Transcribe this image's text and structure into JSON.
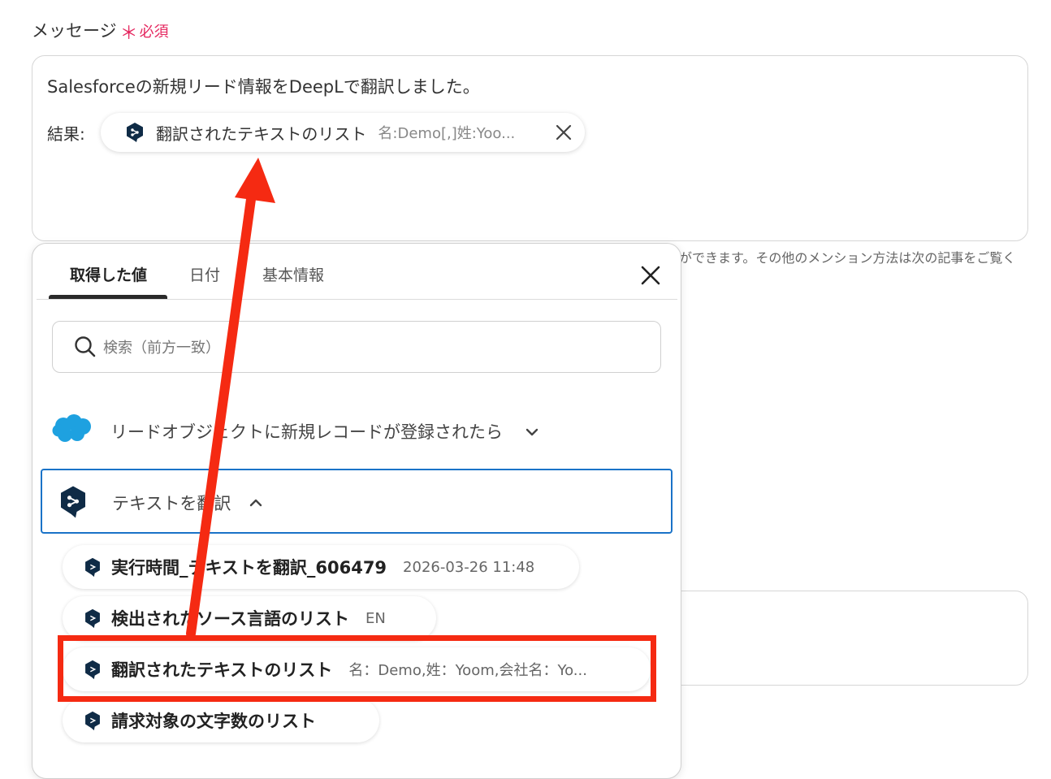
{
  "field": {
    "label": "メッセージ",
    "required_star": "＊",
    "required_text": "必須"
  },
  "message": {
    "line1": "Salesforceの新規リード情報をDeepLで翻訳しました。",
    "result_label": "結果:",
    "chip": {
      "label": "翻訳されたテキストのリスト",
      "value": "名:Demo[,]姓:Yoo..."
    }
  },
  "hint": {
    "text": "ができます。その他のメンション方法は次の記事をご覧く"
  },
  "panel": {
    "tabs": [
      {
        "label": "取得した値",
        "active": true
      },
      {
        "label": "日付",
        "active": false
      },
      {
        "label": "基本情報",
        "active": false
      }
    ],
    "search_placeholder": "検索（前方一致）",
    "groups": [
      {
        "label": "リードオブジェクトに新規レコードが登録されたら",
        "icon": "salesforce-cloud-icon",
        "expanded": false
      },
      {
        "label": "テキストを翻訳",
        "icon": "deepl-icon",
        "expanded": true
      }
    ],
    "items": [
      {
        "label": "実行時間_テキストを翻訳_606479",
        "value": "2026-03-26 11:48"
      },
      {
        "label": "検出されたソース言語のリスト",
        "value": "EN"
      },
      {
        "label": "翻訳されたテキストのリスト",
        "value": "名：Demo,姓：Yoom,会社名：Yo..."
      },
      {
        "label": "請求対象の文字数のリスト",
        "value": ""
      }
    ]
  },
  "colors": {
    "accent_red": "#f52a12",
    "required": "#e5275f",
    "selected_border": "#1a73c8",
    "deepl_navy": "#0f2b46",
    "salesforce_blue": "#1ea1e0"
  }
}
